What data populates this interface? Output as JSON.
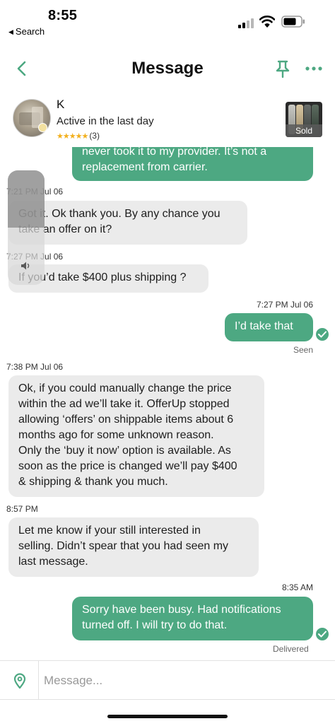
{
  "status_bar": {
    "time": "8:55",
    "back_app_label": "Search"
  },
  "header": {
    "title": "Message",
    "back_icon": "chevron-left-icon",
    "pin_icon": "pin-icon",
    "more_icon": "more-dots-icon",
    "accent_color": "#4da882"
  },
  "seller": {
    "name": "K",
    "status": "Active in the last day",
    "stars": "★★★★★",
    "rating_count": "(3)",
    "listing_badge": "Sold"
  },
  "messages": [
    {
      "direction": "out",
      "text_lines": [
        "never took it to my provider. It’s not a",
        "replacement from carrier."
      ]
    },
    {
      "direction": "in",
      "timestamp": "7:21 PM Jul 06",
      "text_lines": [
        "Got it. Ok thank you. By any chance you",
        "take an offer on it?"
      ]
    },
    {
      "direction": "in",
      "timestamp": "7:27 PM Jul 06",
      "text_lines": [
        "If you’d take $400 plus shipping ?"
      ]
    },
    {
      "direction": "out",
      "timestamp": "7:27 PM Jul 06",
      "text_lines": [
        "I’d take that"
      ],
      "receipt": "Seen"
    },
    {
      "direction": "in",
      "timestamp": "7:38 PM Jul 06",
      "text_lines": [
        "Ok, if you could manually change the price",
        "within the ad we’ll take it. OfferUp stopped",
        "allowing ‘offers’ on shippable items about 6",
        "months ago for some unknown reason.",
        "Only the ‘buy it now’ option is available.  As",
        "soon as the price is changed we’ll pay $400",
        "& shipping & thank you much."
      ]
    },
    {
      "direction": "in",
      "timestamp": "8:57 PM",
      "text_lines": [
        "Let me know if your still interested in",
        "selling.  Didn’t spear that you had seen my",
        "last message."
      ]
    },
    {
      "direction": "out",
      "timestamp": "8:35 AM",
      "text_lines": [
        "Sorry have been busy. Had notifications",
        "turned off.  I will try to do that."
      ],
      "receipt": "Delivered"
    }
  ],
  "composer": {
    "placeholder": "Message...",
    "location_icon": "location-pin-icon"
  },
  "volume_overlay": {
    "level": 0.5,
    "icon": "speaker-icon"
  }
}
